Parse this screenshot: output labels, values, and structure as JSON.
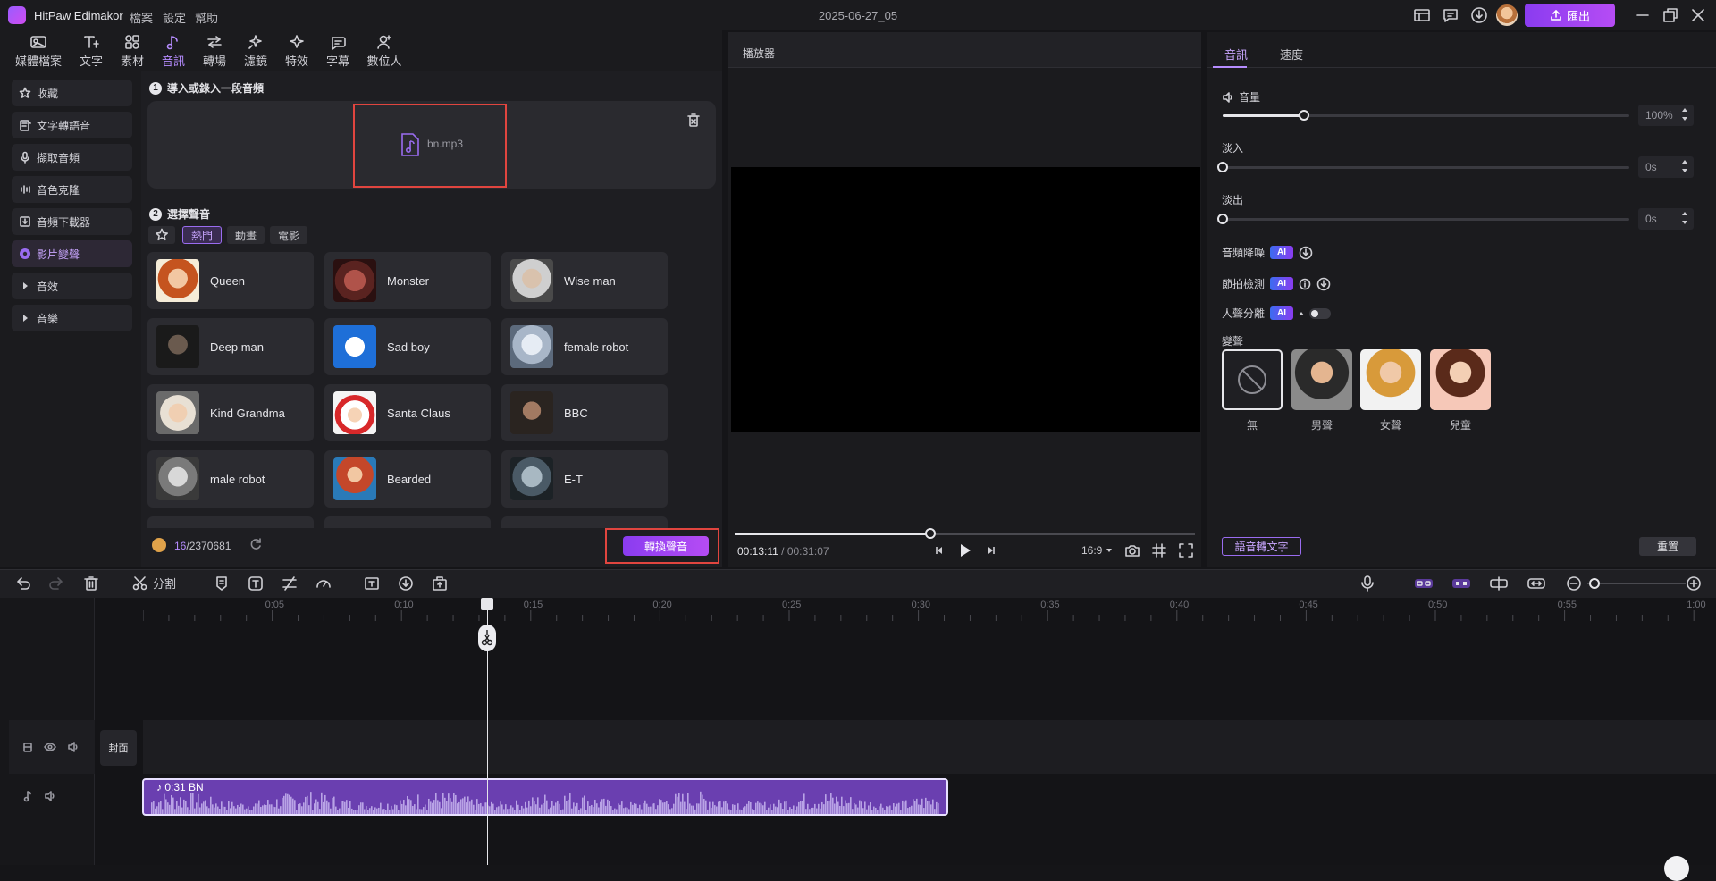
{
  "app": {
    "name": "HitPaw Edimakor",
    "project_title": "2025-06-27_05",
    "export_label": "匯出"
  },
  "menu": [
    "檔案",
    "設定",
    "幫助"
  ],
  "toolbar": [
    {
      "label": "媒體檔案",
      "icon": "media-icon"
    },
    {
      "label": "文字",
      "icon": "text-icon"
    },
    {
      "label": "素材",
      "icon": "elements-icon"
    },
    {
      "label": "音訊",
      "icon": "audio-icon",
      "active": true
    },
    {
      "label": "轉場",
      "icon": "transition-icon"
    },
    {
      "label": "濾鏡",
      "icon": "filter-icon"
    },
    {
      "label": "特效",
      "icon": "effects-icon"
    },
    {
      "label": "字幕",
      "icon": "subtitle-icon"
    },
    {
      "label": "數位人",
      "icon": "avatar-icon"
    }
  ],
  "sidebar": {
    "items": [
      {
        "label": "收藏",
        "icon": "star-icon"
      },
      {
        "label": "文字轉語音",
        "icon": "tts-icon"
      },
      {
        "label": "擷取音頻",
        "icon": "mic-icon"
      },
      {
        "label": "音色克隆",
        "icon": "voice-clone-icon"
      },
      {
        "label": "音頻下載器",
        "icon": "download-icon"
      },
      {
        "label": "影片變聲",
        "icon": "voice-changer-icon",
        "active": true
      },
      {
        "label": "音效",
        "icon": "caret-right-icon"
      },
      {
        "label": "音樂",
        "icon": "caret-right-icon"
      }
    ]
  },
  "audio_panel": {
    "step1": {
      "num": "1",
      "title": "導入或錄入一段音頻"
    },
    "file_name": "bn.mp3",
    "step2": {
      "num": "2",
      "title": "選擇聲音"
    },
    "filters": [
      "熱門",
      "動畫",
      "電影"
    ],
    "active_filter": "熱門",
    "voices": [
      "Queen",
      "Monster",
      "Wise man",
      "Deep man",
      "Sad boy",
      "female robot",
      "Kind Grandma",
      "Santa Claus",
      "BBC",
      "male robot",
      "Bearded",
      "E-T"
    ],
    "credits_used": "16",
    "credits_total": "/2370681",
    "convert_label": "轉換聲音"
  },
  "player": {
    "title": "播放器",
    "current_time": "00:13:11",
    "total_time": " / 00:31:07",
    "aspect": "16:9",
    "progress": 0.4255
  },
  "right_panel": {
    "tabs": [
      "音訊",
      "速度"
    ],
    "volume": {
      "label": "音量",
      "value": "100%",
      "level": 0.2
    },
    "fade_in": {
      "label": "淡入",
      "value": "0s",
      "level": 0
    },
    "fade_out": {
      "label": "淡出",
      "value": "0s",
      "level": 0
    },
    "denoise": {
      "label": "音頻降噪",
      "badge": "AI"
    },
    "beat": {
      "label": "節拍檢測",
      "badge": "AI"
    },
    "vocal_split": {
      "label": "人聲分離",
      "badge": "AI"
    },
    "voice_change": {
      "label": "變聲",
      "options": [
        "無",
        "男聲",
        "女聲",
        "兒童"
      ]
    },
    "stt_label": "語音轉文字",
    "reset_label": "重置"
  },
  "timeline": {
    "split_label": "分割",
    "ticks": [
      "0:05",
      "0:10",
      "0:15",
      "0:20",
      "0:25",
      "0:30",
      "0:35",
      "0:40",
      "0:45",
      "0:50",
      "0:55",
      "1:00"
    ],
    "cover_label": "封面",
    "clip_label": "0:31  BN",
    "playhead_time": 13.18
  },
  "colors": {
    "accent": "#b68cff",
    "accent_gradient_start": "#8a3cf0",
    "highlight": "#e0453f",
    "clip": "#6a3fb0"
  }
}
